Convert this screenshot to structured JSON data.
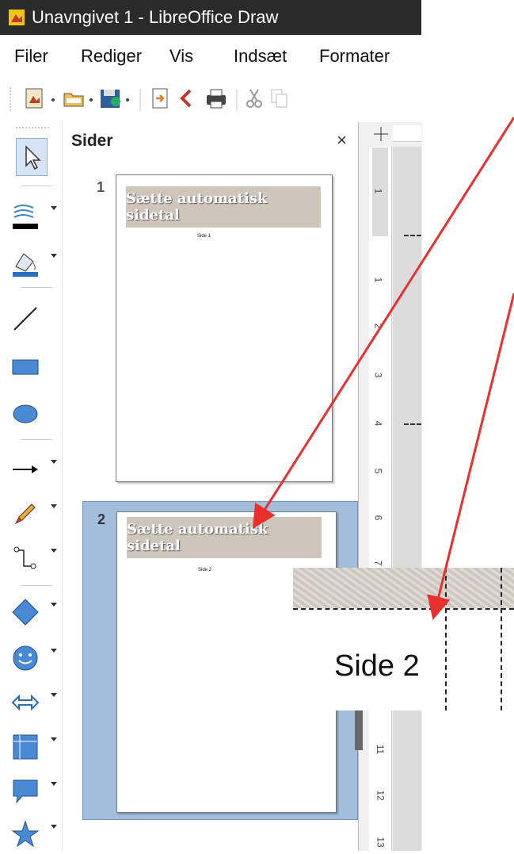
{
  "window": {
    "title": "Unavngivet 1 - LibreOffice Draw"
  },
  "menu": [
    {
      "label": "Filer"
    },
    {
      "label": "Rediger"
    },
    {
      "label": "Vis"
    },
    {
      "label": "Indsæt"
    },
    {
      "label": "Formater"
    }
  ],
  "pages_pane": {
    "title": "Sider",
    "close": "×",
    "pages": [
      {
        "number": "1",
        "banner": "Sætte automatisk sidetal",
        "field": "Side 1",
        "selected": false
      },
      {
        "number": "2",
        "banner": "Sætte automatisk sidetal",
        "field": "Side 2",
        "selected": true
      }
    ]
  },
  "ruler": {
    "numbers": [
      "1",
      "1",
      "2",
      "3",
      "4",
      "5",
      "6",
      "7",
      "11",
      "12",
      "13"
    ]
  },
  "zoom_callout": {
    "text": "Side 2"
  },
  "colors": {
    "annotation_arrow": "#e8302f",
    "selection": "#a3bedb",
    "banner": "#cfc6bb"
  }
}
